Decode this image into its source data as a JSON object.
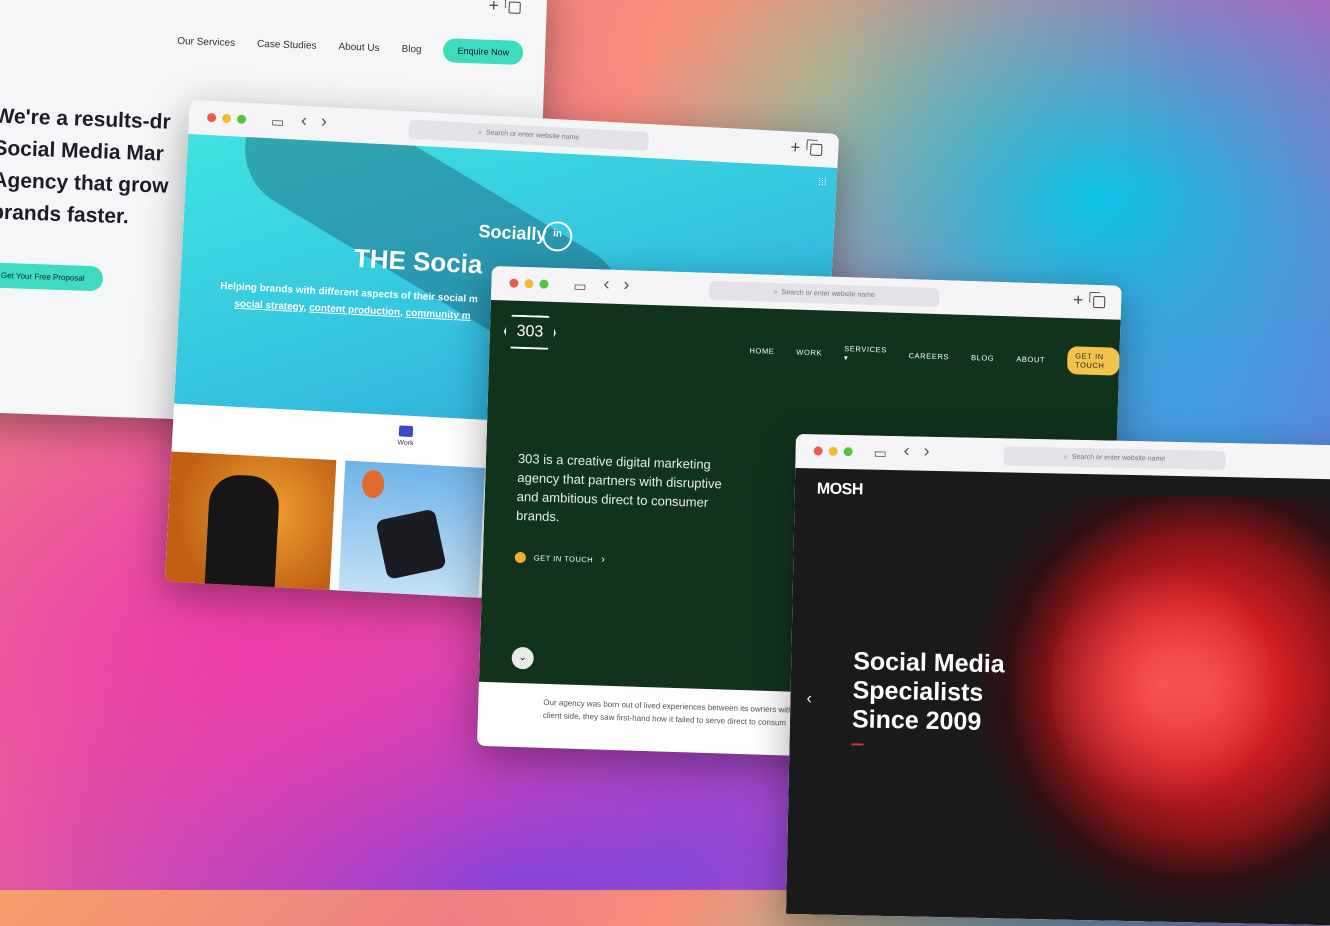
{
  "browser": {
    "url_placeholder": "Search or enter website name",
    "search_icon": "magnifier",
    "new_tab_glyph": "+",
    "back_glyph": "‹",
    "forward_glyph": "›",
    "sidebar_glyph": "▭"
  },
  "site1": {
    "nav": [
      "Our Services",
      "Case Studies",
      "About Us",
      "Blog"
    ],
    "cta_nav": "Enquire Now",
    "hero_lines": [
      "We're a results-dr",
      "Social Media Mar",
      "Agency that grow",
      "brands faster."
    ],
    "cta": "Get Your Free Proposal",
    "accent_color": "#3cdcbd"
  },
  "site2": {
    "logo": "Socially",
    "logo_suffix": "in",
    "title": "THE Socia",
    "subtitle_line1": "Helping brands with different aspects of their social m",
    "subtitle_links": [
      "social strategy",
      "content production",
      "community m"
    ],
    "tab_label": "Work"
  },
  "site3": {
    "logo": "303",
    "nav": [
      "HOME",
      "WORK",
      "SERVICES ▾",
      "CAREERS",
      "BLOG",
      "ABOUT"
    ],
    "cta_nav": "GET IN TOUCH",
    "description": "303 is a creative digital marketing agency that partners with disruptive and ambitious direct to consumer brands.",
    "cta": "GET IN TOUCH",
    "cta_arrow": "›",
    "scroll_glyph": "⌄",
    "footer_line1": "Our agency was born out of lived experiences between its owners with",
    "footer_line2": "client side, they saw first-hand how it failed to serve direct to consum",
    "bg_color": "#11331c",
    "accent_color": "#f2c44c"
  },
  "site4": {
    "logo": "MOSH",
    "headline": [
      "Social Media",
      "Specialists",
      "Since 2009"
    ],
    "prev_glyph": "‹",
    "accent_color": "#e03030"
  }
}
